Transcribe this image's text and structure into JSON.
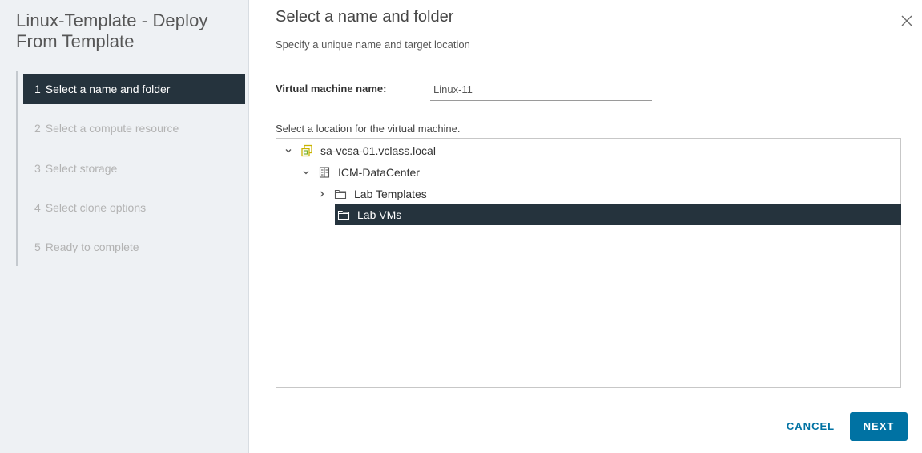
{
  "wizard": {
    "title": "Linux-Template - Deploy From Template",
    "steps": [
      {
        "num": "1",
        "label": "Select a name and folder"
      },
      {
        "num": "2",
        "label": "Select a compute resource"
      },
      {
        "num": "3",
        "label": "Select storage"
      },
      {
        "num": "4",
        "label": "Select clone options"
      },
      {
        "num": "5",
        "label": "Ready to complete"
      }
    ],
    "active_step": 1
  },
  "page": {
    "title": "Select a name and folder",
    "subtitle": "Specify a unique name and target location"
  },
  "vm_name": {
    "label": "Virtual machine name:",
    "value": "Linux-11"
  },
  "location": {
    "label": "Select a location for the virtual machine.",
    "tree": [
      {
        "label": "sa-vcsa-01.vclass.local",
        "icon": "vcenter-icon",
        "expanded": true
      },
      {
        "label": "ICM-DataCenter",
        "icon": "datacenter-icon",
        "expanded": true
      },
      {
        "label": "Lab Templates",
        "icon": "folder-icon",
        "expanded": false
      },
      {
        "label": "Lab VMs",
        "icon": "folder-icon",
        "selected": true
      }
    ]
  },
  "buttons": {
    "cancel": "CANCEL",
    "next": "NEXT"
  },
  "colors": {
    "accent": "#0072a3",
    "selected_bg": "#25333d",
    "sidebar_bg": "#eef1f4"
  }
}
